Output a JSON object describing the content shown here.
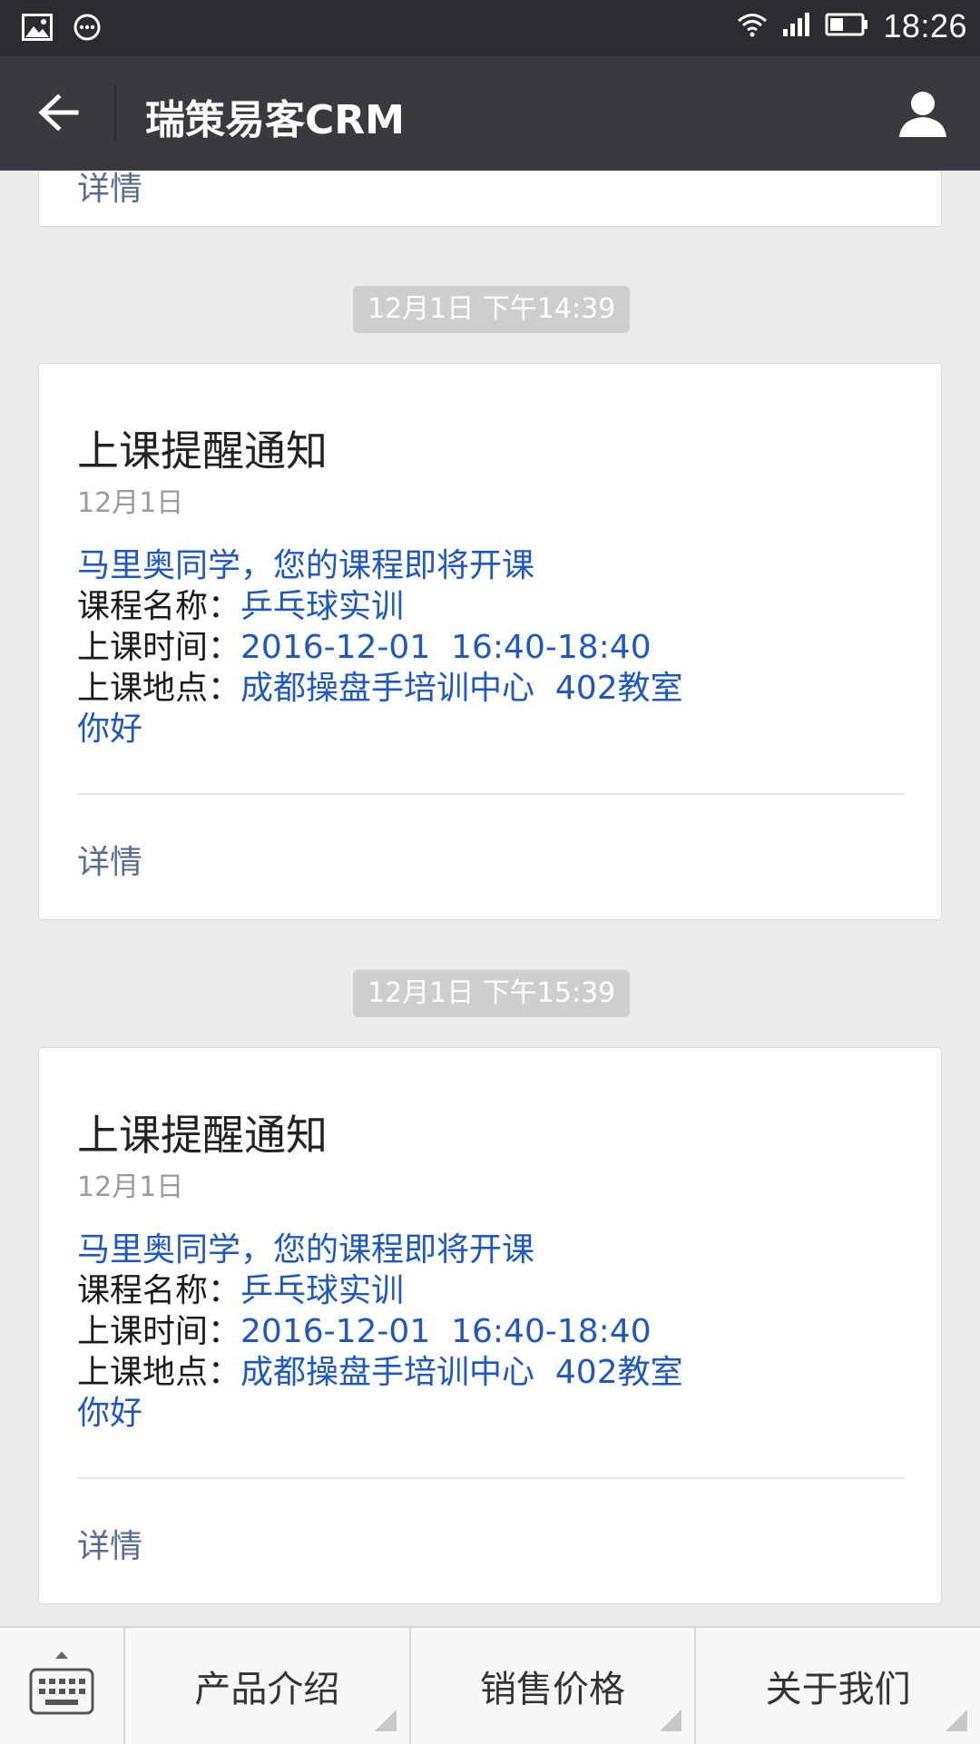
{
  "status_bar": {
    "time": "18:26"
  },
  "header": {
    "title": "瑞策易客CRM"
  },
  "previous_card": {
    "detail_label": "详情"
  },
  "messages": [
    {
      "timestamp": "12月1日 下午14:39",
      "title": "上课提醒通知",
      "date": "12月1日",
      "greeting": "马里奥同学，您的课程即将开课",
      "course_label": "课程名称：",
      "course_value": "乒乓球实训",
      "time_label": "上课时间：",
      "time_value": "2016-12-01  16:40-18:40",
      "location_label": "上课地点：",
      "location_value": "成都操盘手培训中心  402教室",
      "closing": "你好",
      "detail_label": "详情"
    },
    {
      "timestamp": "12月1日 下午15:39",
      "title": "上课提醒通知",
      "date": "12月1日",
      "greeting": "马里奥同学，您的课程即将开课",
      "course_label": "课程名称：",
      "course_value": "乒乓球实训",
      "time_label": "上课时间：",
      "time_value": "2016-12-01  16:40-18:40",
      "location_label": "上课地点：",
      "location_value": "成都操盘手培训中心  402教室",
      "closing": "你好",
      "detail_label": "详情"
    }
  ],
  "bottom_menu": {
    "items": [
      {
        "label": "产品介绍"
      },
      {
        "label": "销售价格"
      },
      {
        "label": "关于我们"
      }
    ]
  },
  "colors": {
    "status_bar": "#2b2c30",
    "title_bar": "#393a3f",
    "background": "#ebebeb",
    "link_blue": "#1e58c6",
    "detail_link": "#576b95",
    "timestamp_bg": "#cecece"
  },
  "icons": [
    "image-icon",
    "message-icon",
    "wifi-icon",
    "signal-icon",
    "battery-icon",
    "back-arrow-icon",
    "user-icon",
    "keyboard-icon"
  ]
}
